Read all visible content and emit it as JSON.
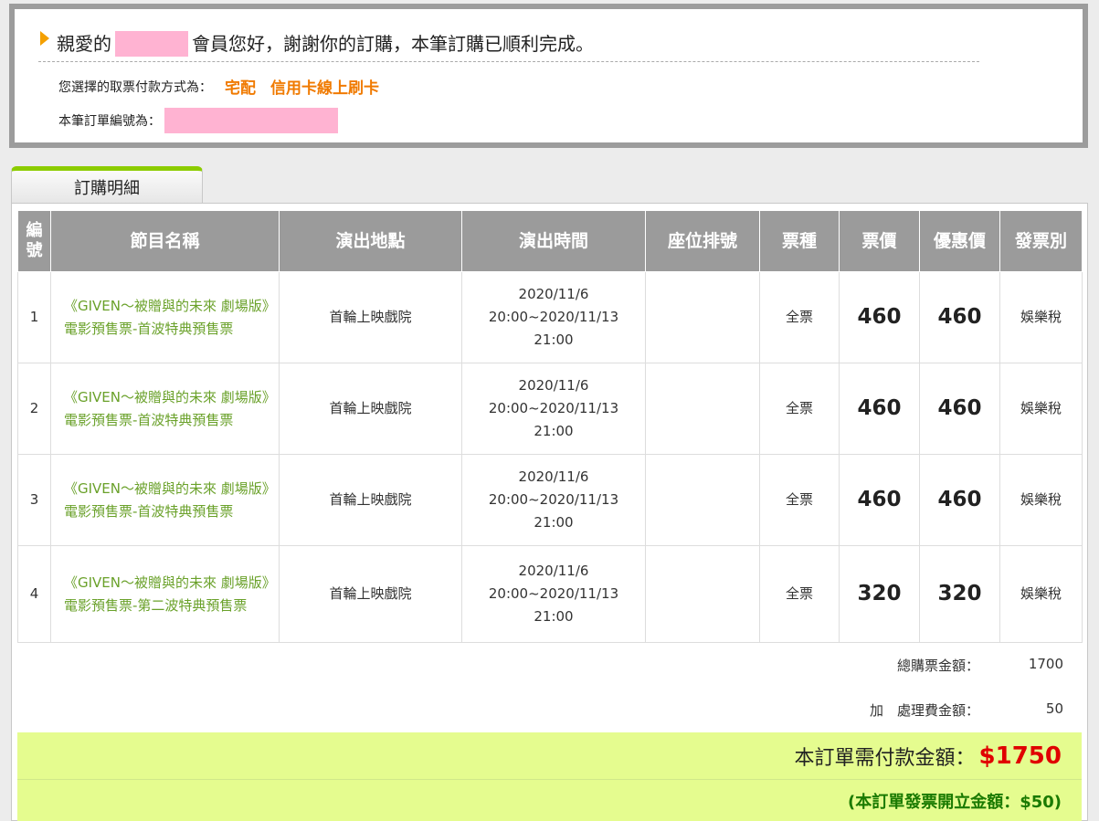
{
  "confirmation": {
    "greeting_prefix": "親愛的",
    "greeting_suffix": "會員您好，謝謝你的訂購，本筆訂購已順利完成。",
    "method_label": "您選擇的取票付款方式為：",
    "delivery_method": "宅配",
    "payment_method": "信用卡線上刷卡",
    "order_no_label": "本筆訂單編號為："
  },
  "tab": {
    "label": "訂購明細"
  },
  "table": {
    "headers": [
      "編號",
      "節目名稱",
      "演出地點",
      "演出時間",
      "座位排號",
      "票種",
      "票價",
      "優惠價",
      "發票別"
    ],
    "rows": [
      {
        "no": "1",
        "name": "《GIVEN～被贈與的未來 劇場版》電影預售票-首波特典預售票",
        "venue": "首輪上映戲院",
        "time1": "2020/11/6",
        "time2": "20:00~2020/11/13",
        "time3": "21:00",
        "seat": "",
        "type": "全票",
        "price": "460",
        "discount": "460",
        "invoice": "娛樂稅"
      },
      {
        "no": "2",
        "name": "《GIVEN～被贈與的未來 劇場版》電影預售票-首波特典預售票",
        "venue": "首輪上映戲院",
        "time1": "2020/11/6",
        "time2": "20:00~2020/11/13",
        "time3": "21:00",
        "seat": "",
        "type": "全票",
        "price": "460",
        "discount": "460",
        "invoice": "娛樂稅"
      },
      {
        "no": "3",
        "name": "《GIVEN～被贈與的未來 劇場版》電影預售票-首波特典預售票",
        "venue": "首輪上映戲院",
        "time1": "2020/11/6",
        "time2": "20:00~2020/11/13",
        "time3": "21:00",
        "seat": "",
        "type": "全票",
        "price": "460",
        "discount": "460",
        "invoice": "娛樂稅"
      },
      {
        "no": "4",
        "name": "《GIVEN～被贈與的未來 劇場版》電影預售票-第二波特典預售票",
        "venue": "首輪上映戲院",
        "time1": "2020/11/6",
        "time2": "20:00~2020/11/13",
        "time3": "21:00",
        "seat": "",
        "type": "全票",
        "price": "320",
        "discount": "320",
        "invoice": "娛樂稅"
      }
    ]
  },
  "summary": {
    "subtotal_label": "總購票金額：",
    "subtotal_value": "1700",
    "fee_label": "加　處理費金額：",
    "fee_value": "50",
    "total_label": "本訂單需付款金額：",
    "total_value": "$1750",
    "invoice_note": "(本訂單發票開立金額：$50)"
  },
  "colors": {
    "accent_green": "#8ccc00",
    "total_red": "#e00000",
    "method_orange": "#f07a00",
    "band_yellow": "#e5fc8f"
  }
}
